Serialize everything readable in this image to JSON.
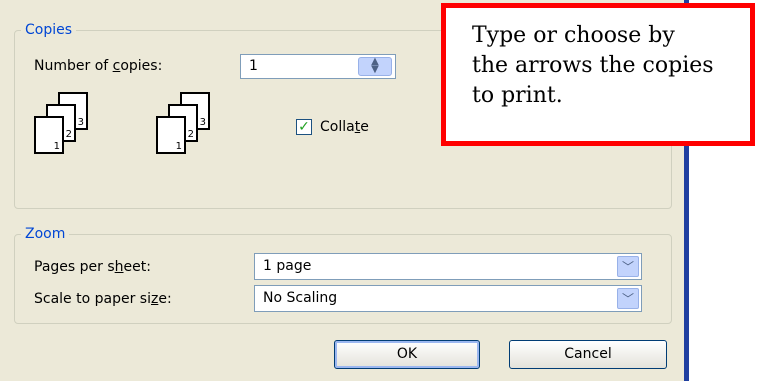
{
  "copies": {
    "group_label": "Copies",
    "number_label_pre": "Number of ",
    "number_label_key": "c",
    "number_label_post": "opies:",
    "number_value": "1",
    "collate_pre": "Colla",
    "collate_key": "t",
    "collate_post": "e",
    "collate_checked": true,
    "stack_page_numbers": [
      "1",
      "2",
      "3"
    ]
  },
  "zoom": {
    "group_label": "Zoom",
    "pages_label_pre": "Pages per s",
    "pages_label_key": "h",
    "pages_label_post": "eet:",
    "pages_value": "1 page",
    "scale_label_pre": "Scale to paper si",
    "scale_label_key": "z",
    "scale_label_post": "e:",
    "scale_value": "No Scaling"
  },
  "buttons": {
    "ok": "OK",
    "cancel": "Cancel"
  },
  "callout": {
    "lines": [
      "Type or choose by",
      "the arrows the copies",
      "to print."
    ]
  },
  "colors": {
    "group_label": "#0046d5",
    "callout_border": "#ff0000",
    "dialog_bg": "#ece9d8"
  }
}
